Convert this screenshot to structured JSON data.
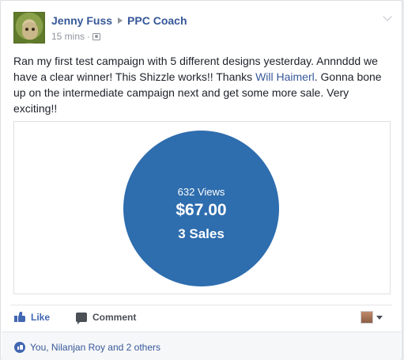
{
  "post": {
    "author": "Jenny Fuss",
    "group": "PPC Coach",
    "timestamp": "15 mins",
    "separator": "·",
    "audience_icon": "audience-icon",
    "text_before": "Ran my first test campaign with 5 different designs yesterday. Annnddd we have a clear winner! This Shizzle works!! Thanks ",
    "mention": "Will Haimerl",
    "text_after": ". Gonna bone up on the intermediate campaign next and get some more sale. Very exciting!!"
  },
  "attachment": {
    "views": "632 Views",
    "amount": "$67.00",
    "sales": "3 Sales",
    "circle_color": "#2e6dae"
  },
  "actions": {
    "like_label": "Like",
    "comment_label": "Comment"
  },
  "reactions": {
    "text": "You, Nilanjan Roy and 2 others"
  },
  "colors": {
    "link": "#365899",
    "like_blue": "#4267b2"
  }
}
